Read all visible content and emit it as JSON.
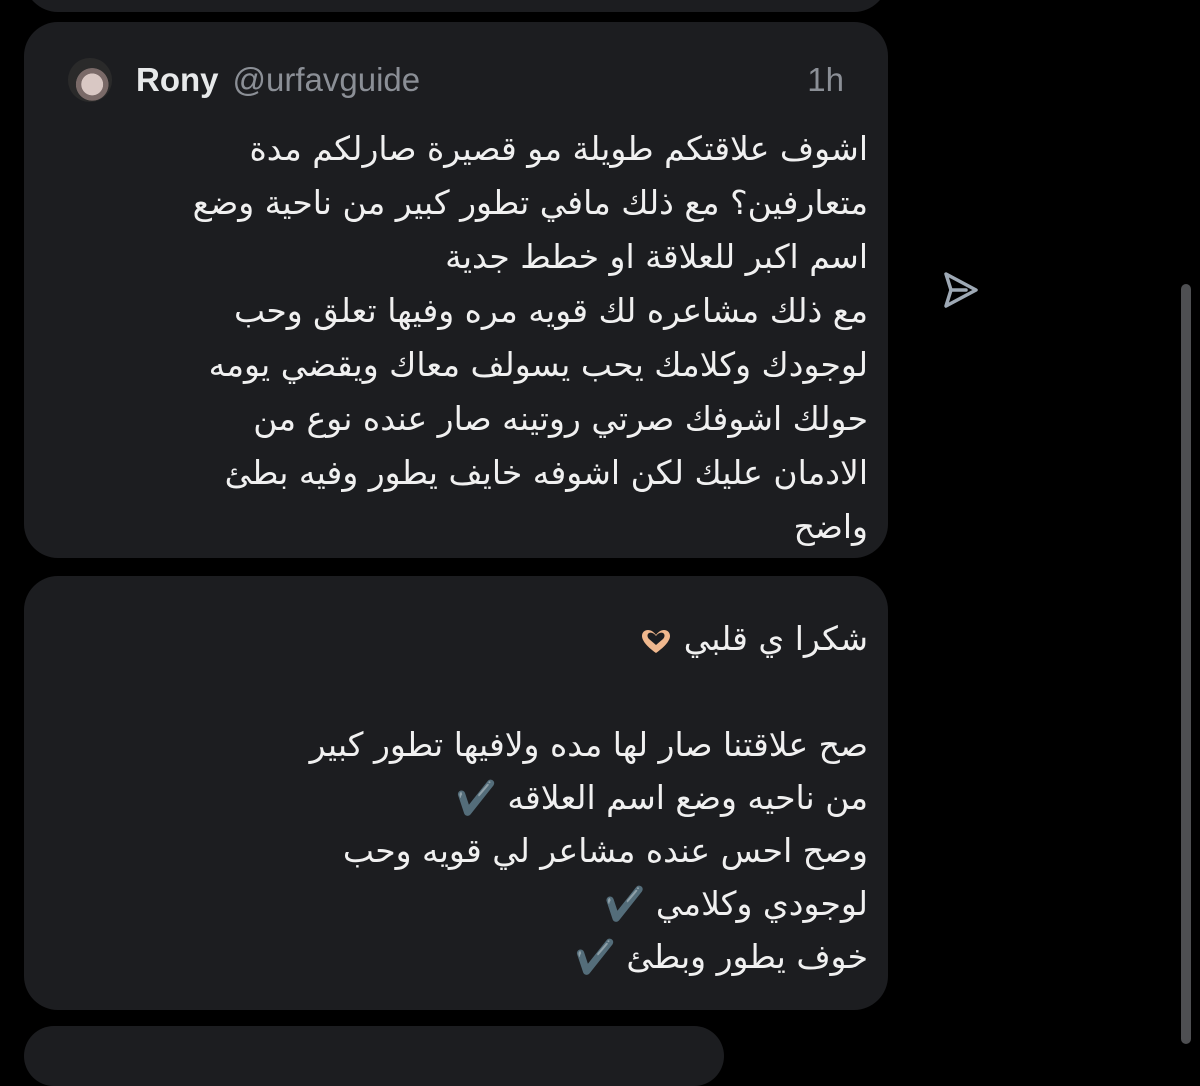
{
  "quoted_tweet": {
    "author_name": "Rony",
    "author_handle": "@urfavguide",
    "timestamp": "1h",
    "lines": [
      "اشوف علاقتكم طويلة مو قصيرة صارلكم مدة",
      "متعارفين؟ مع ذلك مافي تطور كبير من ناحية وضع",
      "اسم اكبر للعلاقة او خطط جدية",
      "مع ذلك مشاعره لك قويه مره وفيها تعلق وحب",
      "لوجودك وكلامك يحب يسولف معاك ويقضي يومه",
      "حولك اشوفك صرتي روتينه صار عنده نوع من",
      "الادمان عليك لكن اشوفه خايف يطور وفيه بطئ",
      "واضح"
    ]
  },
  "reply": {
    "lines": [
      "شكرا ي قلبي",
      "",
      "صح علاقتنا صار لها مده ولافيها تطور كبير",
      "من ناحيه وضع اسم العلاقه ✔️",
      "وصح احس عنده مشاعر لي قويه وحب",
      "لوجودي وكلامي ✔️",
      "خوف يطور وبطئ ✔️"
    ],
    "emoji_icon": "heart-hands-icon"
  },
  "icons": {
    "share": "share-arrow-icon",
    "avatar": "profile-avatar"
  },
  "colors": {
    "background": "#000000",
    "bubble": "#1c1d20",
    "text": "#f0f0f0",
    "secondary_text": "#8b8f96",
    "icon": "#9ea9b5"
  }
}
